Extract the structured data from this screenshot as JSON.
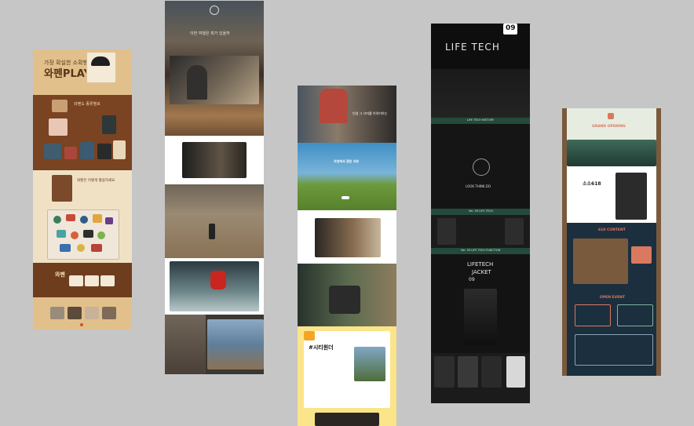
{
  "strips": {
    "patch": {
      "headline_small": "가장 확실한 소확행",
      "headline_big": "와펜PLAY",
      "section1_caption": "와펜도 종류별로",
      "section2_caption": "와펜은 이렇게 활용하세요",
      "footer_title": "와펜",
      "colors": {
        "tan": "#d3ac72",
        "brown": "#6d3d1e",
        "cream": "#f0e1c4",
        "dark": "#5c3217"
      }
    },
    "outdoor": {
      "tagline": "이번 여행은 뭐가 있을까"
    },
    "green": {
      "hero_text": "인생 그 너머를 이야기하는",
      "field_text": "자연에서 찾은 자유",
      "campaign_title": "#시티원더",
      "colors": {
        "sky": "#3f8fc4",
        "field": "#6d9a3c",
        "yellow": "#fbe58a",
        "orange": "#f5a526"
      }
    },
    "lifetech": {
      "badge_number": "09",
      "logo": "LIFE TECH",
      "history_title": "LIFE TECH HISTORY",
      "center_text": "LOOK.THINK.DO",
      "ver_title": "Ver. 09 LIFE TECH",
      "function_title": "Ver. 09 LIFE TECH FUNCTION",
      "jacket_logo": "LIFETECH",
      "jacket_label": "JACKET",
      "jacket_number": "09",
      "colors": {
        "black": "#121212",
        "teal": "#234a3a"
      }
    },
    "cabin": {
      "event_title": "GRAND OPENING",
      "sign_text": "소소618",
      "content_title": "618 CONTENT",
      "open_event": "OPEN EVENT",
      "colors": {
        "navy": "#1c2f3f",
        "mint": "#e6ede0",
        "salmon": "#d9795f",
        "wood": "#7a5a3c"
      }
    }
  }
}
